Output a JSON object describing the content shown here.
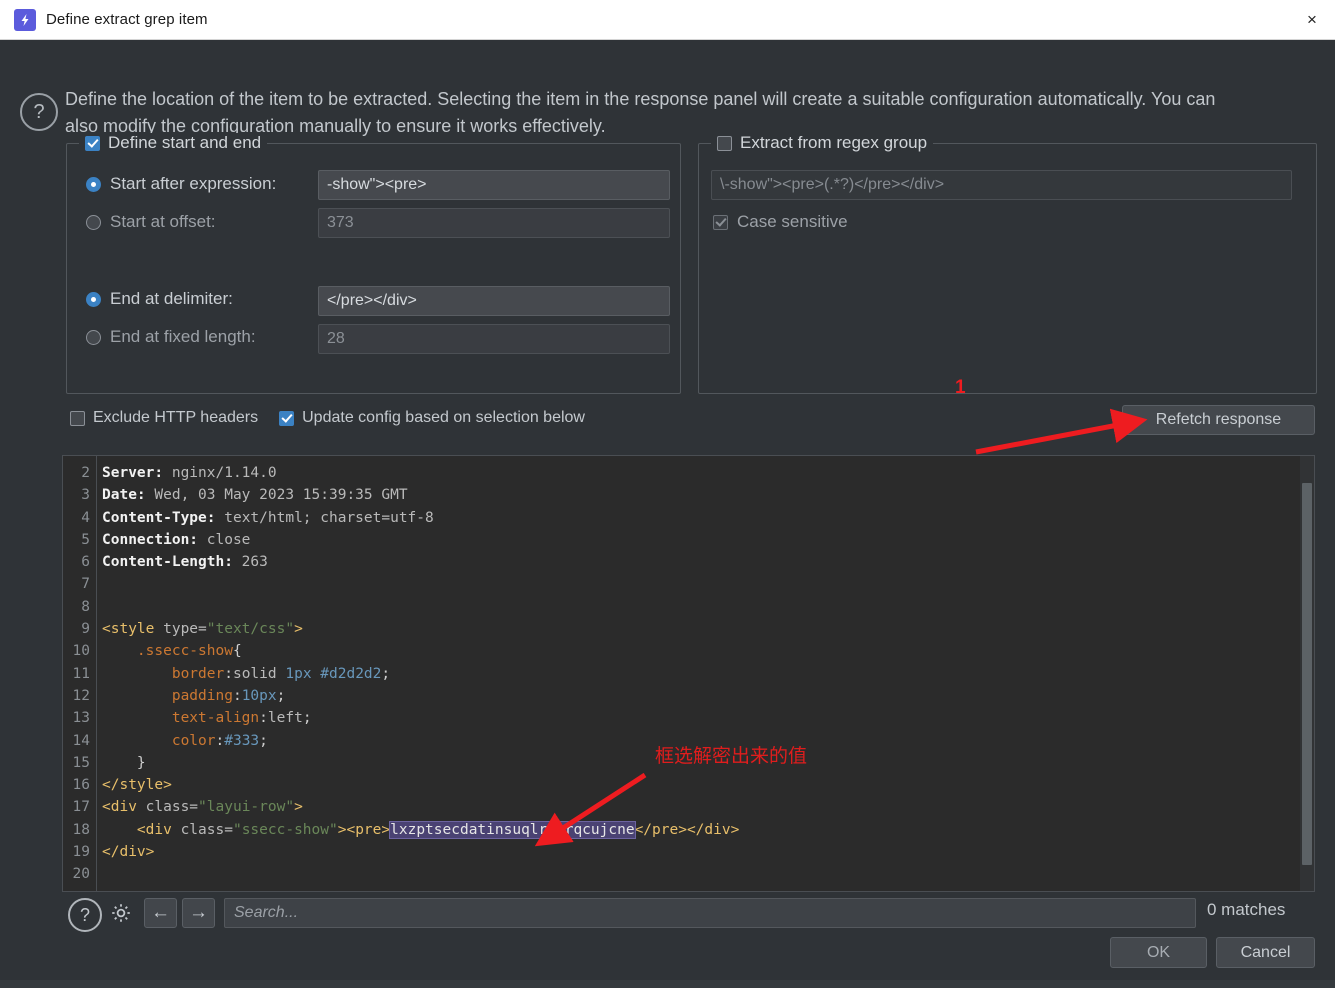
{
  "window": {
    "title": "Define extract grep item",
    "app_icon": "lightning-bolt-icon",
    "close_icon": "×"
  },
  "description": {
    "icon": "question-mark-icon",
    "text": "Define the location of the item to be extracted. Selecting the item in the response panel will create a suitable configuration automatically. You can also modify the configuration manually to ensure it works effectively."
  },
  "start_end_group": {
    "legend": "Define start and end",
    "enabled": true,
    "options": [
      {
        "label": "Start after expression:",
        "selected": true,
        "value": "-show\"><pre>",
        "has_value": true
      },
      {
        "label": "Start at offset:",
        "selected": false,
        "value": "373",
        "has_value": false
      },
      {
        "label": "End at delimiter:",
        "selected": true,
        "value": "</pre></div>",
        "has_value": true
      },
      {
        "label": "End at fixed length:",
        "selected": false,
        "value": "28",
        "has_value": false
      }
    ]
  },
  "regex_group": {
    "legend": "Extract from regex group",
    "enabled": false,
    "pattern": "\\-show\"><pre>(.*?)</pre></div>",
    "case_sensitive_label": "Case sensitive",
    "case_sensitive_checked": true
  },
  "options_row": {
    "exclude_headers_label": "Exclude HTTP headers",
    "exclude_headers_checked": false,
    "update_config_label": "Update config based on selection below",
    "update_config_checked": true,
    "refetch_label": "Refetch response"
  },
  "response": {
    "first_line_number": 2,
    "last_line_number": 20,
    "lines": [
      {
        "n": 2,
        "type": "header",
        "key": "Server:",
        "val": " nginx/1.14.0"
      },
      {
        "n": 3,
        "type": "header",
        "key": "Date:",
        "val": " Wed, 03 May 2023 15:39:35 GMT"
      },
      {
        "n": 4,
        "type": "header",
        "key": "Content-Type:",
        "val": " text/html; charset=utf-8"
      },
      {
        "n": 5,
        "type": "header",
        "key": "Connection:",
        "val": " close"
      },
      {
        "n": 6,
        "type": "header",
        "key": "Content-Length:",
        "val": " 263"
      },
      {
        "n": 7,
        "type": "blank",
        "text": ""
      },
      {
        "n": 8,
        "type": "blank",
        "text": ""
      },
      {
        "n": 9,
        "type": "code",
        "text": "<style type=\"text/css\">"
      },
      {
        "n": 10,
        "type": "code",
        "text": "    .ssecc-show{"
      },
      {
        "n": 11,
        "type": "code",
        "text": "        border:solid 1px #d2d2d2;"
      },
      {
        "n": 12,
        "type": "code",
        "text": "        padding:10px;"
      },
      {
        "n": 13,
        "type": "code",
        "text": "        text-align:left;"
      },
      {
        "n": 14,
        "type": "code",
        "text": "        color:#333;"
      },
      {
        "n": 15,
        "type": "code",
        "text": "    }"
      },
      {
        "n": 16,
        "type": "code",
        "text": "</style>"
      },
      {
        "n": 17,
        "type": "code",
        "text": "<div class=\"layui-row\">"
      },
      {
        "n": 18,
        "type": "code",
        "text": "    <div class=\"ssecc-show\"><pre>lxzptsecdatinsuqlrcxrqcujcne</pre></div>"
      },
      {
        "n": 19,
        "type": "code",
        "text": "</div>"
      },
      {
        "n": 20,
        "type": "blank",
        "text": ""
      }
    ],
    "selected_text": "lxzptsecdatinsuqlrcxrqcujcne",
    "selection_color": "#4a4273"
  },
  "annotations": {
    "marker_1": "1",
    "chinese_note": "框选解密出来的值",
    "color": "#ee1c20"
  },
  "toolbar": {
    "help_icon": "question-mark-icon",
    "settings_icon": "gear-icon",
    "back_icon": "←",
    "forward_icon": "→",
    "search_placeholder": "Search...",
    "search_value": "",
    "matches_text": "0 matches"
  },
  "footer": {
    "ok_label": "OK",
    "cancel_label": "Cancel"
  },
  "colors": {
    "accent": "#3b82c4",
    "dialog_bg": "#2f3337",
    "code_bg": "#2b2b2b",
    "annotation_red": "#ee1c20",
    "icon_purple": "#5b5bdc"
  }
}
